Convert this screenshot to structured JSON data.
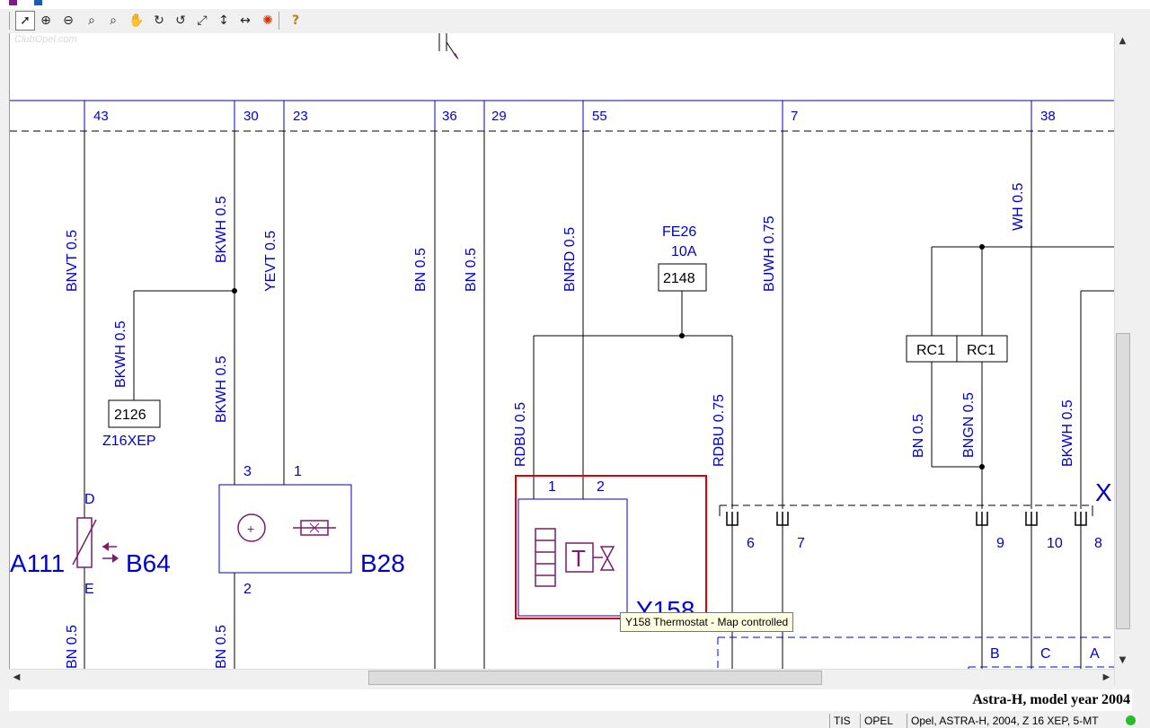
{
  "toolbar": {
    "buttons": [
      {
        "name": "select",
        "glyph": "➚"
      },
      {
        "name": "zoom-in",
        "glyph": "⊕"
      },
      {
        "name": "zoom-out",
        "glyph": "⊖"
      },
      {
        "name": "zoom",
        "glyph": "⌕"
      },
      {
        "name": "zoom-window",
        "glyph": "⌕"
      },
      {
        "name": "pan-hand",
        "glyph": "✋"
      },
      {
        "name": "rotate-right",
        "glyph": "↻"
      },
      {
        "name": "rotate-left",
        "glyph": "↺"
      },
      {
        "name": "fit-page",
        "glyph": "⤢"
      },
      {
        "name": "fit-height",
        "glyph": "↕"
      },
      {
        "name": "fit-width",
        "glyph": "↔"
      },
      {
        "name": "highlight",
        "glyph": "✺"
      },
      {
        "name": "help",
        "glyph": "?"
      }
    ]
  },
  "watermark": "ClubOpel.com",
  "colors": {
    "wire": "#0000cc",
    "symbol": "#7a1c6e",
    "highlight": "#dd0000",
    "wire_line": "#000000"
  },
  "diagram": {
    "columns": [
      "43",
      "30",
      "23",
      "36",
      "29",
      "55",
      "7",
      "38"
    ],
    "wire_labels": {
      "c43": "BNVT 0.5",
      "c30": "BKWH 0.5",
      "c23": "YEVT 0.5",
      "c36": "BN 0.5",
      "c29": "BN 0.5",
      "c55": "BNRD 0.5",
      "c7": "BUWH 0.75",
      "c38": "WH 0.5",
      "branch_2126": "BKWH 0.5",
      "c30_low": "BKWH 0.5",
      "rdbu_left": "RDBU 0.5",
      "rdbu_right": "RDBU 0.75",
      "bn_rc": "BN 0.5",
      "bngn": "BNGN 0.5",
      "bkwh_right": "BKWH 0.5",
      "bottom_43": "BN 0.5",
      "bottom_30": "BN 0.5"
    },
    "fuse": {
      "name": "FE26",
      "rating": "10A",
      "box": "2148"
    },
    "box_2126": "2126",
    "engine_label": "Z16XEP",
    "rc1_left": "RC1",
    "rc1_right": "RC1",
    "sensor": {
      "left": "A111",
      "right": "B64",
      "top_pin": "D",
      "bottom_pin": "E"
    },
    "b28": {
      "label": "B28",
      "pin3": "3",
      "pin1": "1",
      "pin2": "2"
    },
    "y158": {
      "label": "Y158",
      "pin1": "1",
      "pin2": "2",
      "t": "T"
    },
    "connector_x": "X",
    "connector_pins": [
      "6",
      "7",
      "9",
      "10",
      "8"
    ],
    "lower_pins": [
      "B",
      "C",
      "A"
    ]
  },
  "tooltip": "Y158 Thermostat - Map controlled",
  "footer_title": "Astra-H, model year 2004",
  "status": {
    "tis": "TIS",
    "brand": "OPEL",
    "vehicle": "Opel, ASTRA-H, 2004, Z 16 XEP, 5-MT"
  }
}
